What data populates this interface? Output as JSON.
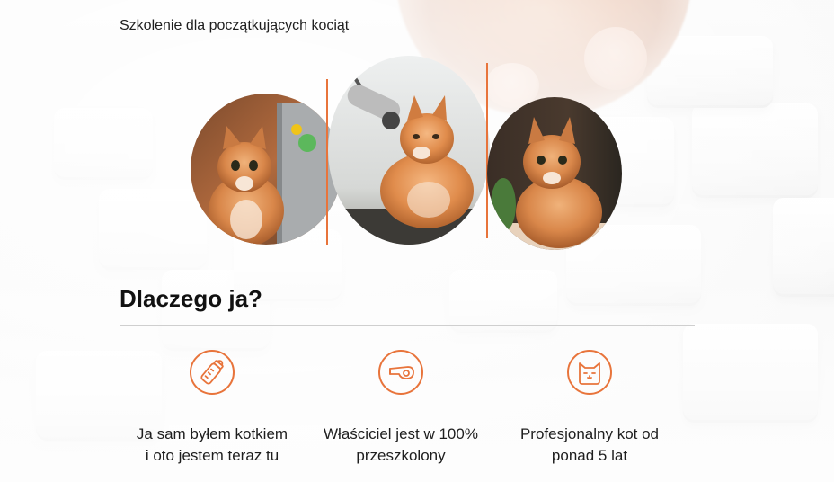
{
  "header": {
    "subtitle": "Szkolenie dla początkujących kociąt"
  },
  "gallery": {
    "images": [
      {
        "description_icon": "cat-with-laptop-photo"
      },
      {
        "description_icon": "cat-with-microphone-photo"
      },
      {
        "description_icon": "cat-sitting-photo"
      }
    ],
    "accent_color": "#e8743b"
  },
  "why_section": {
    "title": "Dlaczego ja?",
    "features": [
      {
        "icon": "baby-bottle-icon",
        "text": "Ja sam byłem kotkiem\ni oto jestem teraz tu"
      },
      {
        "icon": "whistle-icon",
        "text": "Właściciel jest w 100%\nprzeszkolony"
      },
      {
        "icon": "cat-face-icon",
        "text": "Profesjonalny kot od\nponad 5 lat"
      }
    ]
  }
}
